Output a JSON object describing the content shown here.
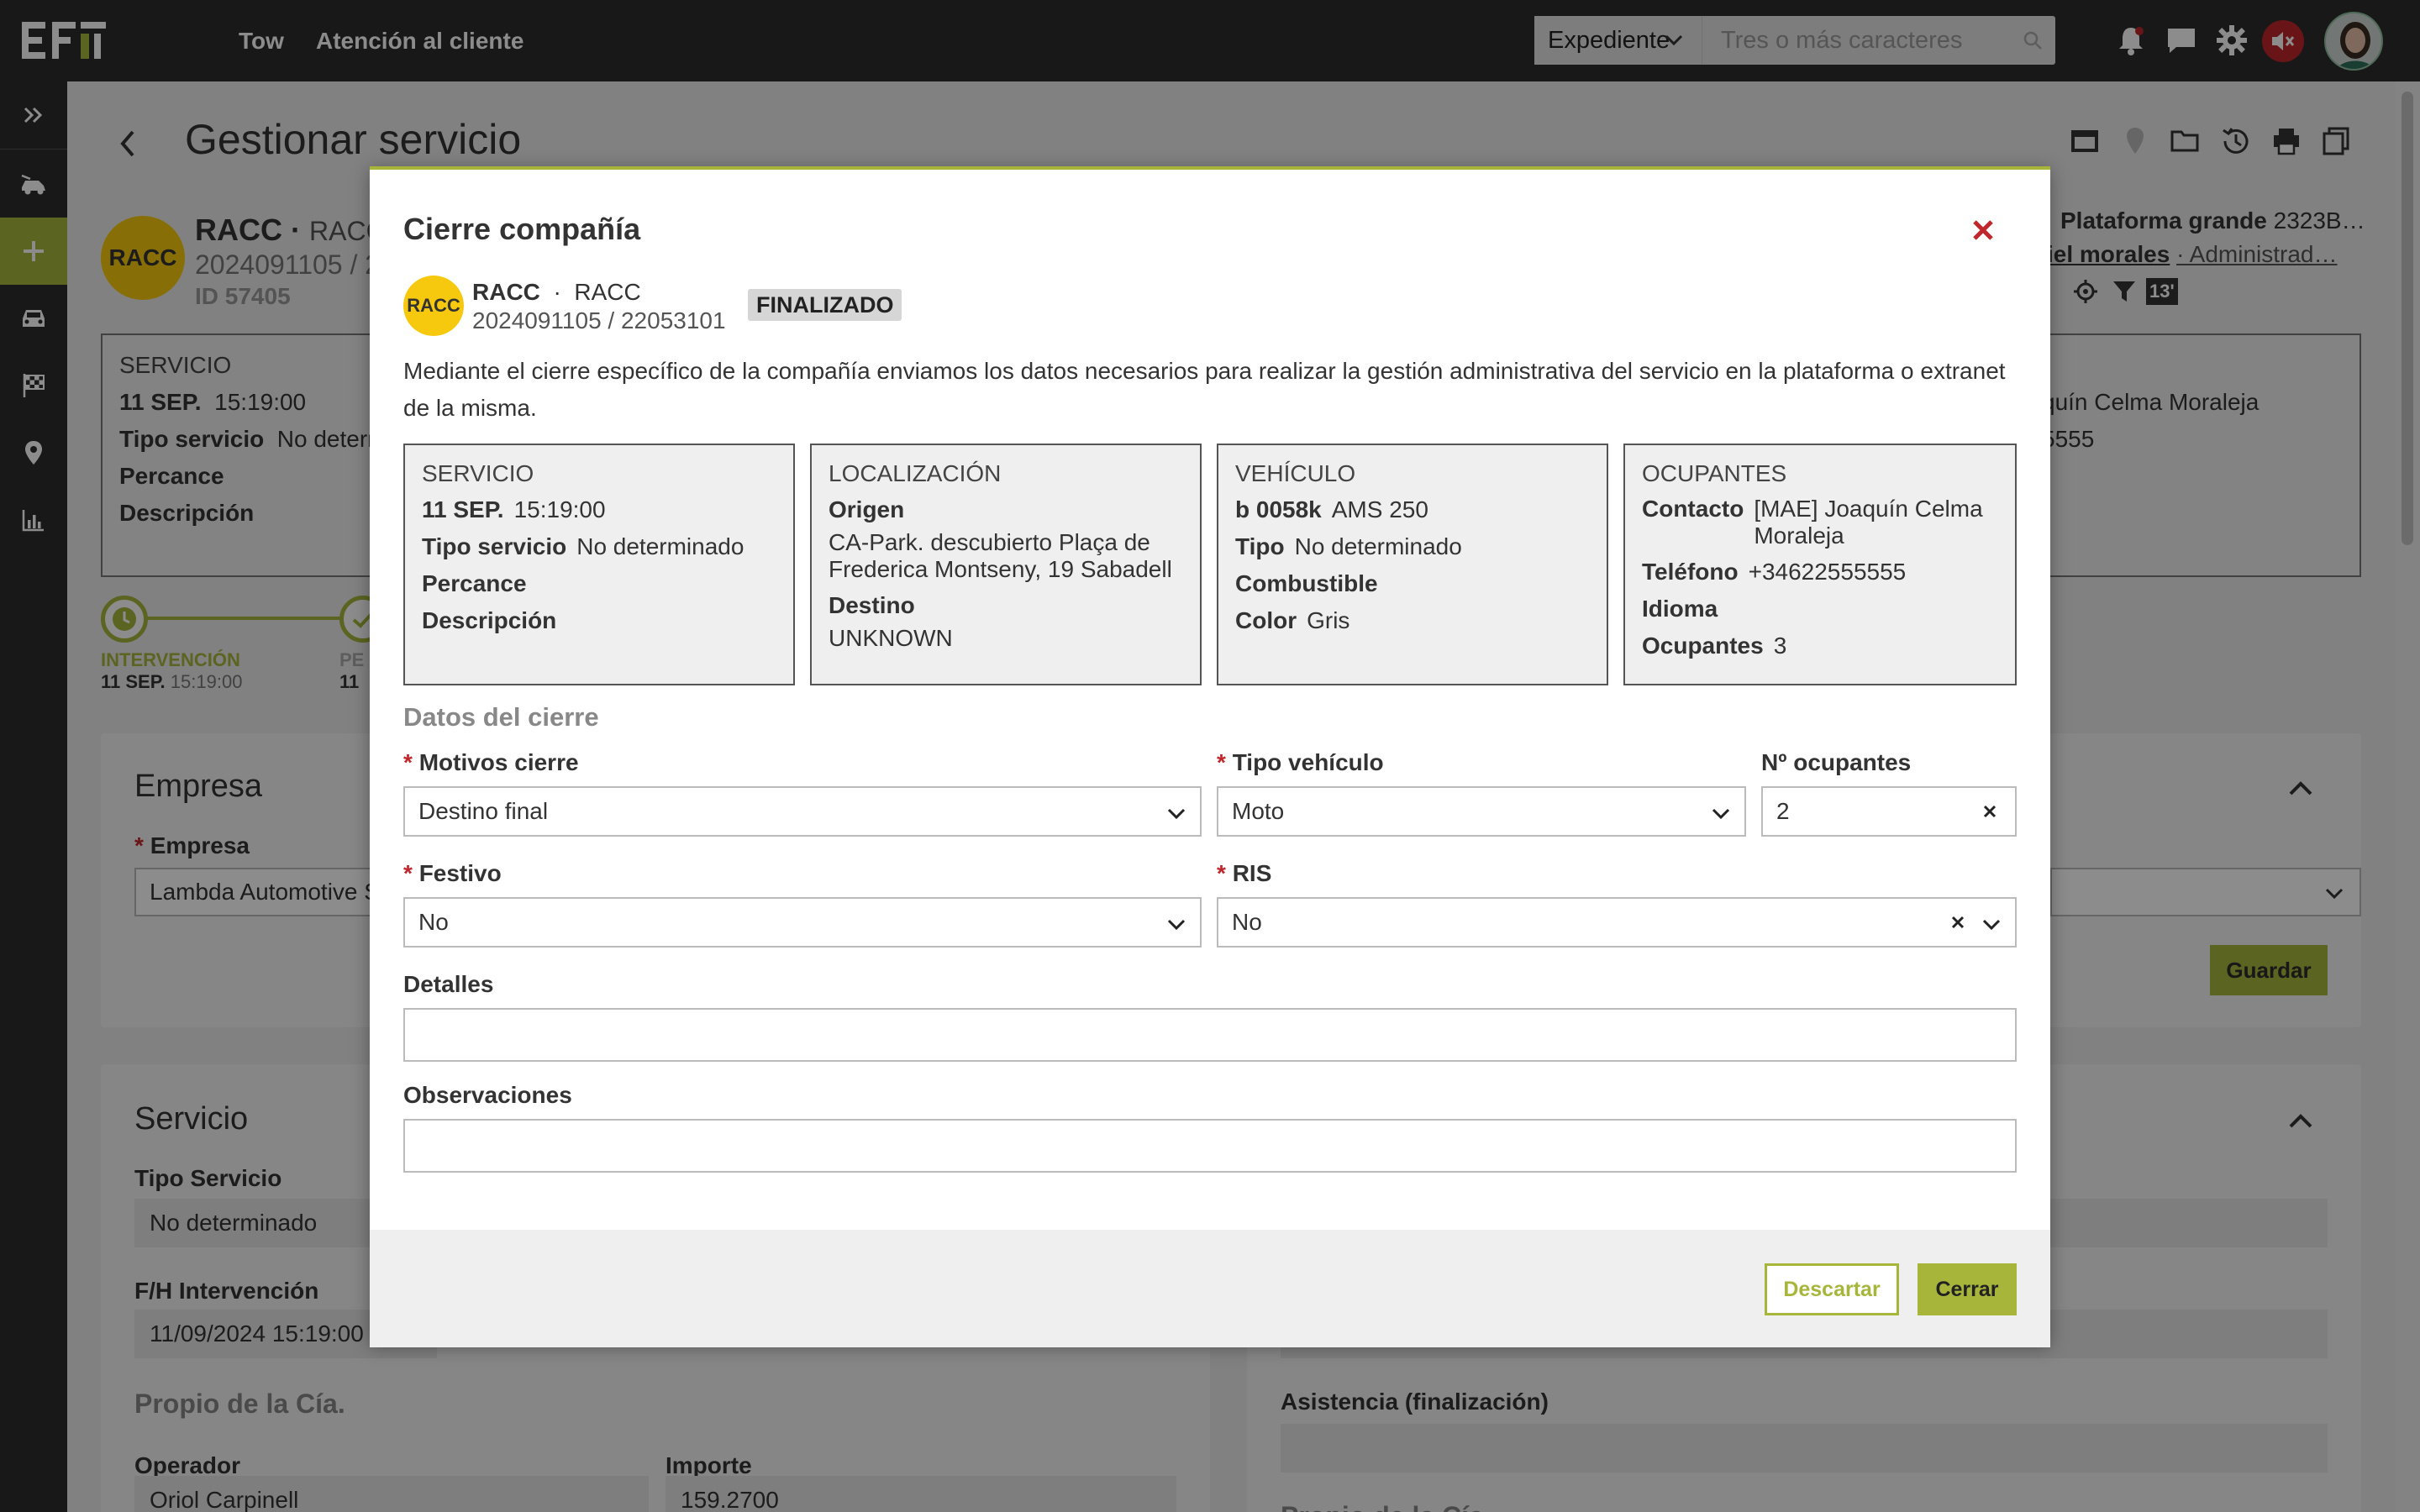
{
  "topbar": {
    "nav": [
      "Tow",
      "Atención al cliente"
    ],
    "search_type": "Expediente",
    "search_placeholder": "Tres o más caracteres"
  },
  "page": {
    "title": "Gestionar servicio",
    "company_short": "RACC",
    "company_name": "RACC",
    "ref": "2024091105 / 2",
    "id": "ID 57405",
    "right_header": {
      "line1_label": "Plataforma grande",
      "line1_value": "2323B…",
      "line2_label": "iel morales",
      "line2_value": "· Administrad…",
      "badge": "13'"
    },
    "service_box": {
      "title": "SERVICIO",
      "date": "11 SEP.",
      "time": "15:19:00",
      "tipo_label": "Tipo servicio",
      "tipo_value": "No determ",
      "percance": "Percance",
      "descripcion": "Descripción"
    },
    "right_box": {
      "line1": "quín Celma Moraleja",
      "line2": "5555"
    },
    "timeline": [
      {
        "label": "INTERVENCIÓN",
        "date": "11 SEP.",
        "time": "15:19:00"
      },
      {
        "label": "PE",
        "date": "11"
      }
    ],
    "empresa": {
      "title": "Empresa",
      "field_label": "Empresa",
      "field_value": "Lambda Automotive S",
      "save": "Guardar"
    },
    "servicio": {
      "title": "Servicio",
      "tipo_label": "Tipo Servicio",
      "tipo_value": "No determinado",
      "fh_label": "F/H Intervención",
      "fh_value": "11/09/2024 15:19:00",
      "propio": "Propio de la Cía.",
      "operador_label": "Operador",
      "operador_value": "Oriol Carpinell",
      "importe_label": "Importe",
      "importe_value": "159.2700",
      "asistencia_label": "Asistencia (finalización)",
      "propio_right": "Propio de la Cía."
    }
  },
  "modal": {
    "title": "Cierre compañía",
    "company_short": "RACC",
    "company_name": "RACC",
    "company_name2": "RACC",
    "ref": "2024091105 / 22053101",
    "status": "FINALIZADO",
    "description": "Mediante el cierre específico de la compañía enviamos los datos necesarios para realizar la gestión administrativa del servicio en la plataforma o extranet de la misma.",
    "servicio": {
      "title": "SERVICIO",
      "date": "11 SEP.",
      "time": "15:19:00",
      "tipo_label": "Tipo servicio",
      "tipo_value": "No determinado",
      "percance": "Percance",
      "descripcion": "Descripción"
    },
    "localizacion": {
      "title": "LOCALIZACIÓN",
      "origen_label": "Origen",
      "origen_value": "CA-Park. descubierto Plaça de Frederica Montseny, 19 Sabadell",
      "destino_label": "Destino",
      "destino_value": "UNKNOWN"
    },
    "vehiculo": {
      "title": "VEHÍCULO",
      "plate": "b 0058k",
      "model": "AMS 250",
      "tipo_label": "Tipo",
      "tipo_value": "No determinado",
      "combustible_label": "Combustible",
      "color_label": "Color",
      "color_value": "Gris"
    },
    "ocupantes": {
      "title": "OCUPANTES",
      "contacto_label": "Contacto",
      "contacto_value": "[MAE] Joaquín Celma Moraleja",
      "telefono_label": "Teléfono",
      "telefono_value": "+34622555555",
      "idioma_label": "Idioma",
      "ocupantes_label": "Ocupantes",
      "ocupantes_value": "3"
    },
    "datos_title": "Datos del cierre",
    "motivos_label": "Motivos cierre",
    "motivos_value": "Destino final",
    "tipo_vehiculo_label": "Tipo vehículo",
    "tipo_vehiculo_value": "Moto",
    "n_ocupantes_label": "Nº ocupantes",
    "n_ocupantes_value": "2",
    "festivo_label": "Festivo",
    "festivo_value": "No",
    "ris_label": "RIS",
    "ris_value": "No",
    "detalles_label": "Detalles",
    "observaciones_label": "Observaciones",
    "discard": "Descartar",
    "close": "Cerrar",
    "required_mark": "*"
  },
  "colors": {
    "accent": "#a7b63b",
    "dark": "#2c2c2c",
    "danger": "#c0272d",
    "racc": "#f6c90e"
  }
}
